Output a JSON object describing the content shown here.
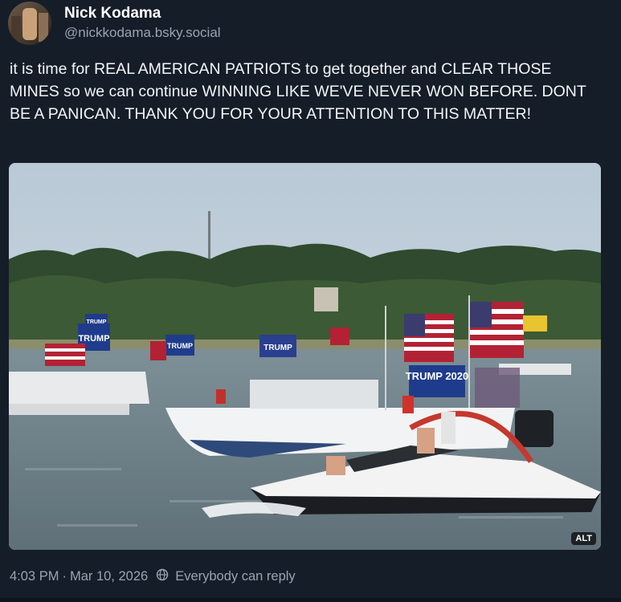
{
  "author": {
    "display_name": "Nick Kodama",
    "handle": "@nickkodama.bsky.social"
  },
  "post": {
    "text": "it is time for REAL AMERICAN PATRIOTS to get together and CLEAR THOSE MINES so we can continue WINNING LIKE WE'VE NEVER WON BEFORE. DONT BE A PANICAN. THANK YOU FOR YOUR ATTENTION TO THIS MATTER!",
    "alt_badge": "ALT",
    "image_flag_texts": [
      "TRUMP",
      "TRUMP",
      "TRUMP",
      "TRUMP",
      "TRUMP 2020"
    ]
  },
  "footer": {
    "time": "4:03 PM",
    "separator": "·",
    "date": "Mar 10, 2026",
    "reply_setting": "Everybody can reply"
  },
  "icons": [
    "avatar",
    "globe-icon"
  ],
  "colors": {
    "background": "#151d28",
    "text": "#f1f3f5",
    "muted": "#9aa4b1"
  }
}
